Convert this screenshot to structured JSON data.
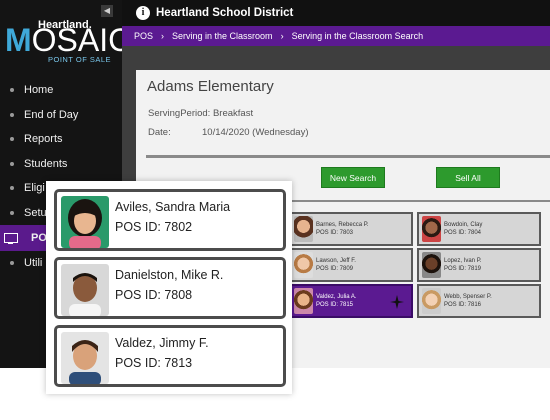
{
  "sidebar": {
    "logo_brand": "Heartland.",
    "logo_name_m": "M",
    "logo_name_rest": "OSAIC",
    "logo_tagline": "POINT OF SALE",
    "collapse_icon": "chevron-left-icon",
    "items": [
      {
        "label": "Home"
      },
      {
        "label": "End of Day"
      },
      {
        "label": "Reports"
      },
      {
        "label": "Students"
      },
      {
        "label": "Eligi"
      },
      {
        "label": "Setu"
      },
      {
        "label": "PO"
      },
      {
        "label": "Utili"
      }
    ]
  },
  "topbar": {
    "district": "Heartland School District"
  },
  "breadcrumb": [
    "POS",
    "Serving in the Classroom",
    "Serving in the Classroom Search"
  ],
  "main": {
    "school": "Adams Elementary",
    "serving_period": "ServingPeriod: Breakfast",
    "date_label": "Date:",
    "date_value": "10/14/2020 (Wednesday)",
    "new_search": "New Search",
    "sell_all": "Sell All"
  },
  "background_cards": [
    {
      "name": "Barnes, Rebecca P.",
      "pos": "POS ID: 7803"
    },
    {
      "name": "Bowdoin, Clay",
      "pos": "POS ID: 7804"
    },
    {
      "name": "Lawson, Jeff F.",
      "pos": "POS ID: 7809"
    },
    {
      "name": "Lopez, Ivan P.",
      "pos": "POS ID: 7819"
    },
    {
      "name": "Valdez, Julia A.",
      "pos": "POS ID: 7815"
    },
    {
      "name": "Webb, Spenser P.",
      "pos": "POS ID: 7816"
    }
  ],
  "cards": [
    {
      "name": "Aviles, Sandra Maria",
      "pos": "POS ID: 7802"
    },
    {
      "name": "Danielston, Mike R.",
      "pos": "POS ID: 7808"
    },
    {
      "name": "Valdez, Jimmy F.",
      "pos": "POS ID: 7813"
    }
  ],
  "colors": {
    "accent_purple": "#5b1a91",
    "button_green": "#2d9a2d",
    "sidebar_bg": "#141414",
    "logo_blue": "#3fa9d9"
  }
}
